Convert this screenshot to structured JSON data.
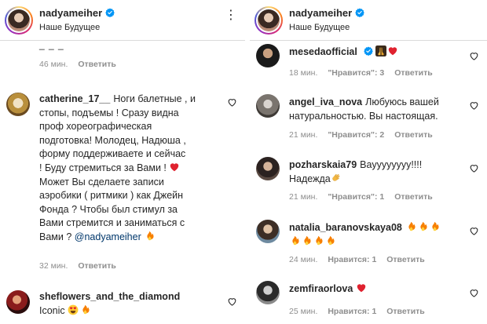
{
  "left_panel": {
    "header": {
      "username": "nadyameiher",
      "subtitle": "Наше Будущее",
      "more": "⋮"
    },
    "partial_text": "_ _ _",
    "comments": [
      {
        "meta": {
          "time": "46 мин.",
          "reply": "Ответить"
        }
      },
      {
        "username": "catherine_17__",
        "text_lines": [
          "Ноги балетные , и",
          "стопы, подъемы ! Сразу видна",
          "проф хореографическая",
          "подготовка! Молодец, Надюша ,",
          "форму поддерживаете и сейчас",
          "! Буду стремиться за Вами !",
          "Может Вы сделаете записи",
          "аэробики ( ритмики ) как Джейн",
          "Фонда ? Чтобы был стимул за",
          "Вами стремится и заниматься с",
          "Вами ?"
        ],
        "mention": "@nadyameiher",
        "meta": {
          "time": "32 мин.",
          "reply": "Ответить"
        }
      },
      {
        "username": "sheflowers_and_the_diamond",
        "text": "Iconic"
      }
    ]
  },
  "right_panel": {
    "header": {
      "username": "nadyameiher",
      "subtitle": "Наше Будущее"
    },
    "comments": [
      {
        "username": "mesedaofficial",
        "meta": {
          "time": "18 мин.",
          "likes": "\"Нравится\": 3",
          "reply": "Ответить"
        }
      },
      {
        "username": "angel_iva_nova",
        "text": "Любуюсь вашей натуральностью. Вы настоящая.",
        "meta": {
          "time": "21 мин.",
          "likes": "\"Нравится\": 2",
          "reply": "Ответить"
        }
      },
      {
        "username": "pozharskaia79",
        "text": "Вауууууууу!!!!",
        "text2": "Надежда",
        "meta": {
          "time": "21 мин.",
          "likes": "\"Нравится\": 1",
          "reply": "Ответить"
        }
      },
      {
        "username": "natalia_baranovskaya08",
        "meta": {
          "time": "24 мин.",
          "likes": "Нравится: 1",
          "reply": "Ответить"
        }
      },
      {
        "username": "zemfiraorlova",
        "meta": {
          "time": "25 мин.",
          "likes": "Нравится: 1",
          "reply": "Ответить"
        }
      }
    ]
  },
  "colors": {
    "text": "#262626",
    "secondary": "#8e8e8e",
    "verified": "#0095f6",
    "mention": "#00376b",
    "heart": "#ed4956",
    "fire": "#f77f00"
  },
  "icons": [
    "verified-badge-icon",
    "heart-outline-icon",
    "red-heart-emoji",
    "fire-emoji",
    "heart-eyes-emoji",
    "praying-hands-emoji",
    "clapping-hands-emoji",
    "more-options-icon"
  ]
}
